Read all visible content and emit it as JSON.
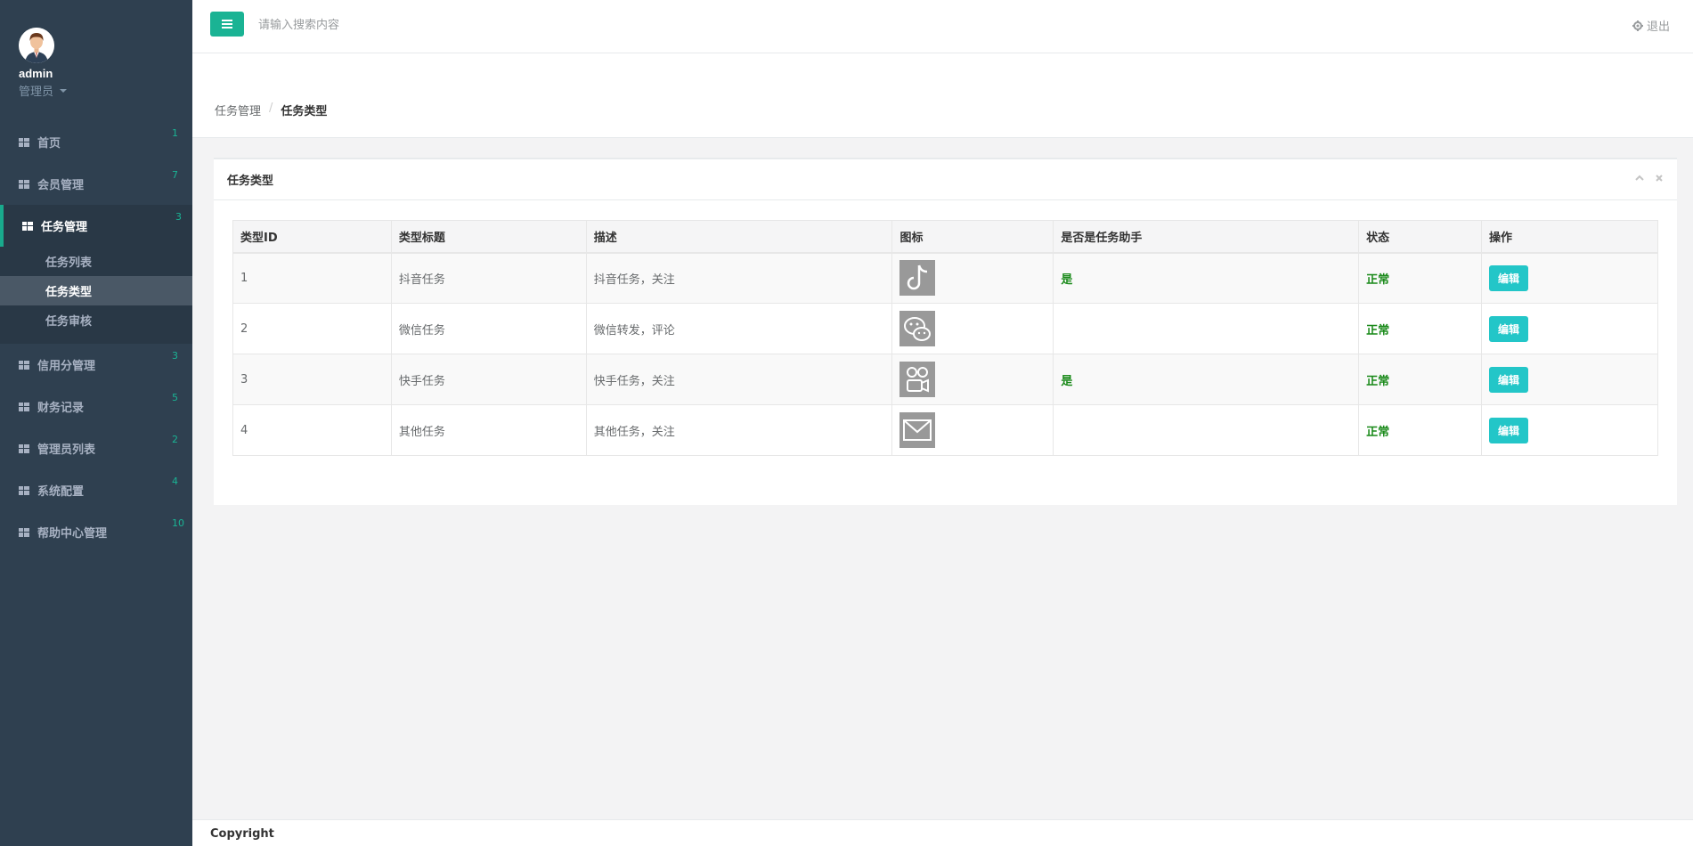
{
  "sidebar": {
    "profile": {
      "name": "admin",
      "role": "管理员"
    },
    "items": [
      {
        "label": "首页",
        "badge": "1"
      },
      {
        "label": "会员管理",
        "badge": "7"
      },
      {
        "label": "任务管理",
        "badge": "3"
      },
      {
        "label": "信用分管理",
        "badge": "3"
      },
      {
        "label": "财务记录",
        "badge": "5"
      },
      {
        "label": "管理员列表",
        "badge": "2"
      },
      {
        "label": "系统配置",
        "badge": "4"
      },
      {
        "label": "帮助中心管理",
        "badge": "10"
      }
    ],
    "subitems": [
      {
        "label": "任务列表"
      },
      {
        "label": "任务类型"
      },
      {
        "label": "任务审核"
      }
    ]
  },
  "topbar": {
    "search_placeholder": "请输入搜索内容",
    "logout_label": "退出"
  },
  "breadcrumb": {
    "parent": "任务管理",
    "sep": "/",
    "current": "任务类型"
  },
  "panel": {
    "title": "任务类型",
    "columns": [
      "类型ID",
      "类型标题",
      "描述",
      "图标",
      "是否是任务助手",
      "状态",
      "操作"
    ],
    "rows": [
      {
        "id": "1",
        "title": "抖音任务",
        "desc": "抖音任务，关注",
        "icon": "douyin-icon",
        "assistant": "是",
        "status": "正常",
        "action": "编辑"
      },
      {
        "id": "2",
        "title": "微信任务",
        "desc": "微信转发，评论",
        "icon": "wechat-icon",
        "assistant": "",
        "status": "正常",
        "action": "编辑"
      },
      {
        "id": "3",
        "title": "快手任务",
        "desc": "快手任务，关注",
        "icon": "kuaishou-icon",
        "assistant": "是",
        "status": "正常",
        "action": "编辑"
      },
      {
        "id": "4",
        "title": "其他任务",
        "desc": "其他任务，关注",
        "icon": "mail-icon",
        "assistant": "",
        "status": "正常",
        "action": "编辑"
      }
    ]
  },
  "footer": {
    "text": "Copyright"
  },
  "colors": {
    "accent": "#1ab394",
    "sidebar": "#2f4050",
    "info": "#23c6c8",
    "status_ok": "#1a8a1a"
  }
}
